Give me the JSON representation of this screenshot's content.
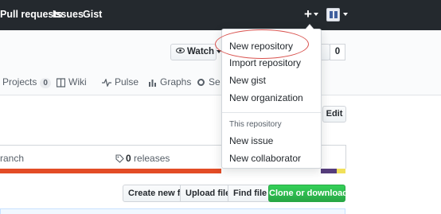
{
  "header": {
    "nav": [
      "Pull requests",
      "Issues",
      "Gist"
    ],
    "plus": "+"
  },
  "repohead": {
    "watch_label": "Watch",
    "star_count": "0",
    "tabs": [
      {
        "label": "Projects",
        "count": "0"
      },
      {
        "label": "Wiki"
      },
      {
        "label": "Pulse"
      },
      {
        "label": "Graphs"
      },
      {
        "label": "Se"
      }
    ]
  },
  "dropdown": {
    "items": [
      "New repository",
      "Import repository",
      "New gist",
      "New organization"
    ],
    "section_header": "This repository",
    "repo_items": [
      "New issue",
      "New collaborator"
    ]
  },
  "content": {
    "edit_label": "Edit",
    "branch_text": "ranch",
    "releases_count": "0",
    "releases_label": "releases",
    "buttons": {
      "create_file": "Create new file",
      "upload_files": "Upload files",
      "find_file": "Find file",
      "clone": "Clone or download"
    }
  },
  "colors": {
    "header_bg": "#24292e",
    "lang_orange": "#e34c26",
    "lang_purple": "#563d7c",
    "lang_yellow": "#f1e05a",
    "clone_green": "#28a745",
    "annotation_red": "#d9534f"
  }
}
